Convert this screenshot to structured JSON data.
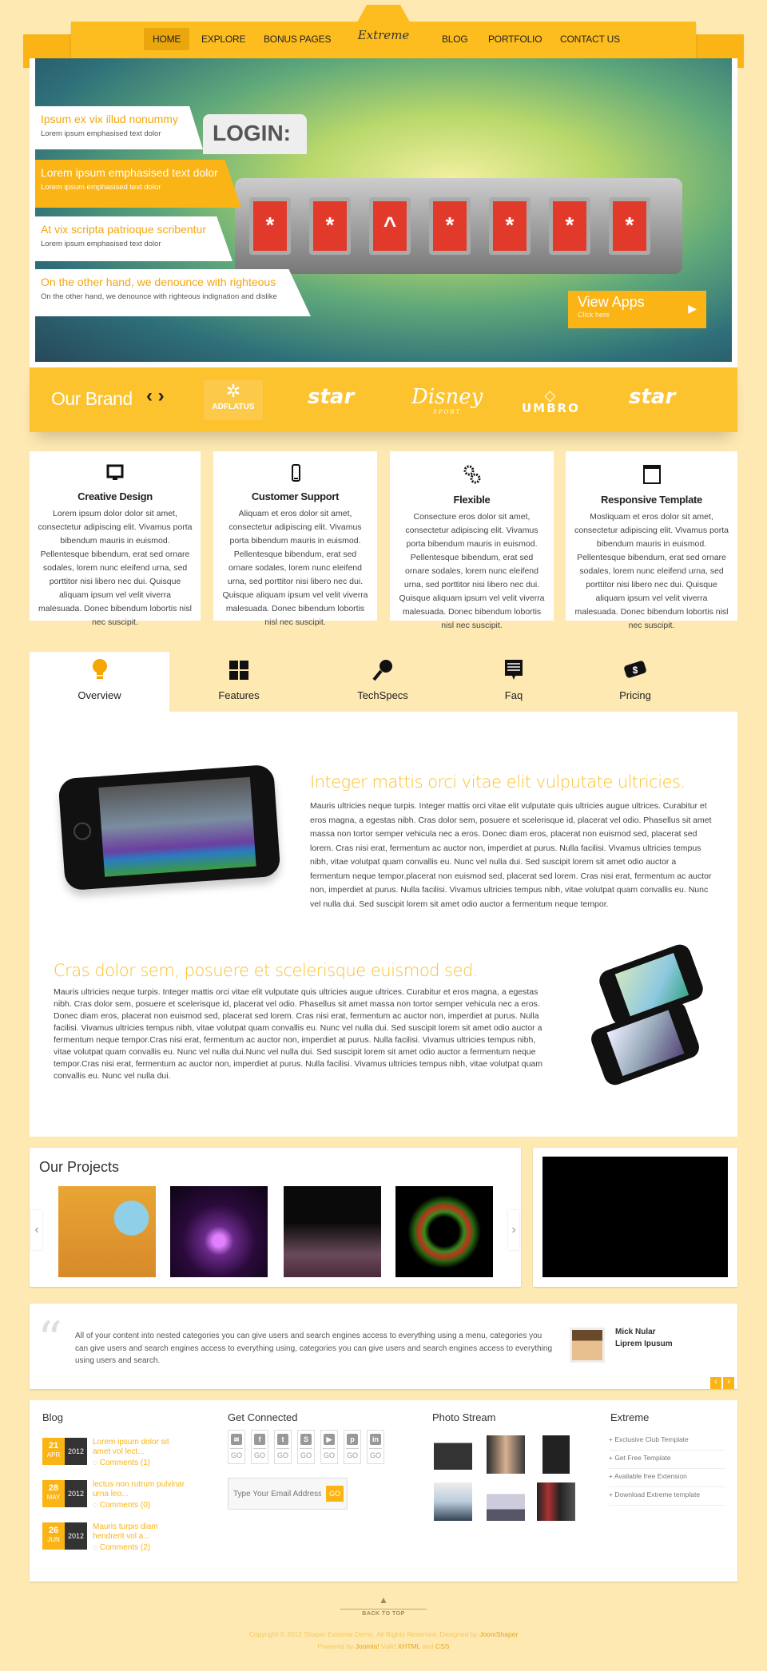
{
  "nav": {
    "items": [
      "HOME",
      "EXPLORE",
      "BONUS PAGES",
      "BLOG",
      "PORTFOLIO",
      "CONTACT US"
    ],
    "active": "HOME",
    "logo": "Extreme"
  },
  "hero": {
    "image_text": "LOGIN:",
    "lock_chars": [
      "*",
      "*",
      "^",
      "*",
      "*",
      "*",
      "*"
    ],
    "captions": [
      {
        "title": "Ipsum ex vix illud nonummy",
        "subtitle": "Lorem ipsum emphasised text dolor"
      },
      {
        "title": "Lorem ipsum emphasised text dolor",
        "subtitle": "Lorem ipsum emphasised text dolor"
      },
      {
        "title": "At vix scripta patrioque scribentur",
        "subtitle": "Lorem ipsum emphasised text dolor"
      },
      {
        "title": "On the other hand, we denounce with righteous",
        "subtitle": "On the other hand, we denounce with righteous indignation and dislike"
      }
    ],
    "cta": {
      "title": "View Apps",
      "subtitle": "Click here"
    }
  },
  "brand": {
    "title": "Our Brand",
    "logos": [
      "ADFLATUS",
      "star",
      "Disney",
      "UMBRO",
      "star"
    ],
    "disney_sub": "SPORT"
  },
  "features": [
    {
      "icon": "monitor-icon",
      "title": "Creative Design",
      "text": "Lorem ipsum dolor dolor sit amet, consectetur adipiscing elit. Vivamus porta bibendum mauris in euismod. Pellentesque bibendum, erat sed ornare sodales, lorem nunc eleifend urna, sed porttitor nisi libero nec dui. Quisque aliquam ipsum vel velit viverra malesuada. Donec bibendum lobortis nisl nec suscipit."
    },
    {
      "icon": "phone-icon",
      "title": "Customer Support",
      "text": "Aliquam et eros dolor sit amet, consectetur adipiscing elit. Vivamus porta bibendum mauris in euismod. Pellentesque bibendum, erat sed ornare sodales, lorem nunc eleifend urna, sed porttitor nisi libero nec dui. Quisque aliquam ipsum vel velit viverra malesuada. Donec bibendum lobortis nisl nec suscipit."
    },
    {
      "icon": "gears-icon",
      "title": "Flexible",
      "text": "Consecture eros dolor sit amet, consectetur adipiscing elit. Vivamus porta bibendum mauris in euismod. Pellentesque bibendum, erat sed ornare sodales, lorem nunc eleifend urna, sed porttitor nisi libero nec dui. Quisque aliquam ipsum vel velit viverra malesuada. Donec bibendum lobortis nisl nec suscipit."
    },
    {
      "icon": "browser-window-icon",
      "title": "Responsive Template",
      "text": "Mosliquam et eros dolor sit amet, consectetur adipiscing elit. Vivamus porta bibendum mauris in euismod. Pellentesque bibendum, erat sed ornare sodales, lorem nunc eleifend urna, sed porttitor nisi libero nec dui. Quisque aliquam ipsum vel velit viverra malesuada. Donec bibendum lobortis nisl nec suscipit."
    }
  ],
  "tabs": [
    {
      "label": "Overview",
      "icon": "lightbulb-icon"
    },
    {
      "label": "Features",
      "icon": "grid-icon"
    },
    {
      "label": "TechSpecs",
      "icon": "microphone-icon"
    },
    {
      "label": "Faq",
      "icon": "chat-icon"
    },
    {
      "label": "Pricing",
      "icon": "money-icon"
    }
  ],
  "overview": {
    "heading1": "Integer mattis orci vitae elit vulputate ultricies.",
    "para1": "Mauris ultricies neque turpis. Integer mattis orci vitae elit vulputate quis ultricies augue ultrices. Curabitur et eros magna, a egestas nibh. Cras dolor sem, posuere et scelerisque id, placerat vel odio. Phasellus sit amet massa non tortor semper vehicula nec a eros. Donec diam eros, placerat non euismod sed, placerat sed lorem. Cras nisi erat, fermentum ac auctor non, imperdiet at purus. Nulla facilisi. Vivamus ultricies tempus nibh, vitae volutpat quam convallis eu. Nunc vel nulla dui. Sed suscipit lorem sit amet odio auctor a fermentum neque tempor.placerat non euismod sed, placerat sed lorem. Cras nisi erat, fermentum ac auctor non, imperdiet at purus. Nulla facilisi. Vivamus ultricies tempus nibh, vitae volutpat quam convallis eu. Nunc vel nulla dui. Sed suscipit lorem sit amet odio auctor a fermentum neque tempor.",
    "heading2": "Cras dolor sem, posuere et scelerisque euismod sed.",
    "para2": "Mauris ultricies neque turpis. Integer mattis orci vitae elit vulputate quis ultricies augue ultrices. Curabitur et eros magna, a egestas nibh. Cras dolor sem, posuere et scelerisque id, placerat vel odio. Phasellus sit amet massa non tortor semper vehicula nec a eros. Donec diam eros, placerat non euismod sed, placerat sed lorem. Cras nisi erat, fermentum ac auctor non, imperdiet at purus. Nulla facilisi. Vivamus ultricies tempus nibh, vitae volutpat quam convallis eu. Nunc vel nulla dui. Sed suscipit lorem sit amet odio auctor a fermentum neque tempor.Cras nisi erat, fermentum ac auctor non, imperdiet at purus. Nulla facilisi. Vivamus ultricies tempus nibh, vitae volutpat quam convallis eu. Nunc vel nulla dui.Nunc vel nulla dui. Sed suscipit lorem sit amet odio auctor a fermentum neque tempor.Cras nisi erat, fermentum ac auctor non, imperdiet at purus. Nulla facilisi. Vivamus ultricies tempus nibh, vitae volutpat quam convallis eu. Nunc vel nulla dui."
  },
  "projects": {
    "title": "Our Projects",
    "prev": "‹",
    "next": "›"
  },
  "testimonial": {
    "text": "All of your content into nested categories you can give users and search engines access to everything using a menu, categories you can give users and search engines access to everything using, categories you can give users and search engines access to everything using users and search.",
    "name": "Mick Nular",
    "role": "Liprem Ipusum",
    "prev": "‹",
    "next": "›"
  },
  "footer": {
    "blog": {
      "title": "Blog",
      "posts": [
        {
          "day": "21",
          "month": "APR",
          "year": "2012",
          "title": "Lorem ipsum dolor sit amet vol lect...",
          "comments": "Comments (1)"
        },
        {
          "day": "28",
          "month": "MAY",
          "year": "2012",
          "title": "lectus non rutrum pulvinar urna leo...",
          "comments": "Comments (0)"
        },
        {
          "day": "26",
          "month": "JUN",
          "year": "2012",
          "title": "Mauris turpis diam hendrerit vol a...",
          "comments": "Comments (2)"
        }
      ]
    },
    "connected": {
      "title": "Get Connected",
      "social": [
        {
          "icon": "rss-icon",
          "glyph": "≋",
          "go": "GO"
        },
        {
          "icon": "facebook-icon",
          "glyph": "f",
          "go": "GO"
        },
        {
          "icon": "twitter-icon",
          "glyph": "t",
          "go": "GO"
        },
        {
          "icon": "skype-icon",
          "glyph": "S",
          "go": "GO"
        },
        {
          "icon": "youtube-icon",
          "glyph": "▶",
          "go": "GO"
        },
        {
          "icon": "pinterest-icon",
          "glyph": "p",
          "go": "GO"
        },
        {
          "icon": "linkedin-icon",
          "glyph": "in",
          "go": "GO"
        }
      ],
      "email_placeholder": "Type Your Email Address",
      "go": "GO"
    },
    "photos": {
      "title": "Photo Stream"
    },
    "extreme": {
      "title": "Extreme",
      "links": [
        "+ Exclusive Club Template",
        "+ Get Free Template",
        "+ Available free Extension",
        "+ Download Extreme template"
      ]
    },
    "back_to_top": "BACK TO TOP",
    "copyright": "Copyright © 2012 Shaper Extreme Demo. All Rights Reserved. Designed by ",
    "designer": "JoomShaper",
    "powered_pre": "Powered by ",
    "joomla": "Joomla!",
    "valid": " Valid ",
    "xhtml": "XHTML",
    "and": " and ",
    "css": "CSS"
  },
  "colors": {
    "accent": "#fbb416",
    "background": "#fee9b3",
    "dark": "#333333"
  }
}
